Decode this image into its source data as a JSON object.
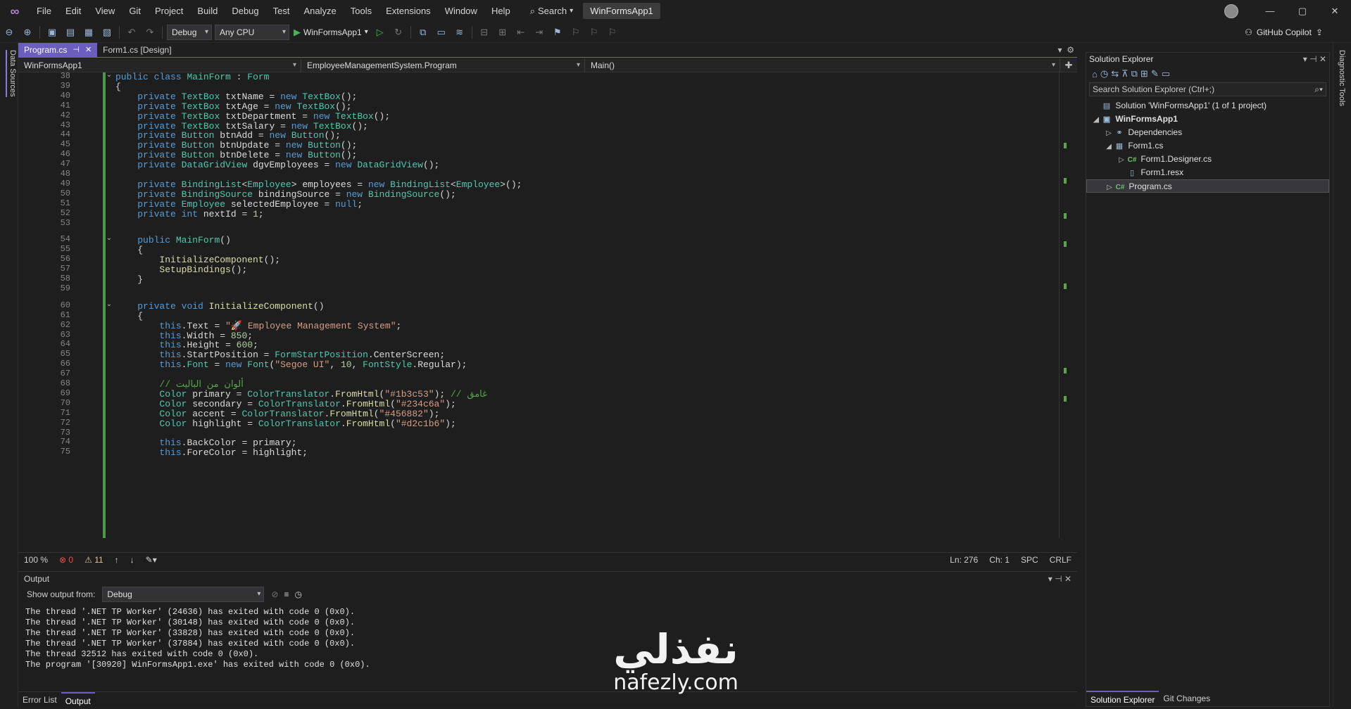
{
  "titlebar": {
    "menu": [
      "File",
      "Edit",
      "View",
      "Git",
      "Project",
      "Build",
      "Debug",
      "Test",
      "Analyze",
      "Tools",
      "Extensions",
      "Window",
      "Help"
    ],
    "search_label": "Search",
    "project_title": "WinFormsApp1",
    "window_controls": [
      "—",
      "▢",
      "✕"
    ]
  },
  "toolbar": {
    "config": "Debug",
    "platform": "Any CPU",
    "run_target": "WinFormsApp1",
    "copilot_label": "GitHub Copilot"
  },
  "left_rail": {
    "label": "Data Sources"
  },
  "right_rail": {
    "label": "Diagnostic Tools"
  },
  "editor": {
    "tabs": [
      {
        "label": "Program.cs",
        "active": true
      },
      {
        "label": "Form1.cs [Design]",
        "active": false
      }
    ],
    "nav": {
      "project": "WinFormsApp1",
      "type": "EmployeeManagementSystem.Program",
      "member": "Main()"
    },
    "lines": [
      {
        "n": "38",
        "code": "public class MainForm : Form"
      },
      {
        "n": "39",
        "code": "{"
      },
      {
        "n": "40",
        "code": "    private TextBox txtName = new TextBox();"
      },
      {
        "n": "41",
        "code": "    private TextBox txtAge = new TextBox();"
      },
      {
        "n": "42",
        "code": "    private TextBox txtDepartment = new TextBox();"
      },
      {
        "n": "43",
        "code": "    private TextBox txtSalary = new TextBox();"
      },
      {
        "n": "44",
        "code": "    private Button btnAdd = new Button();"
      },
      {
        "n": "45",
        "code": "    private Button btnUpdate = new Button();"
      },
      {
        "n": "46",
        "code": "    private Button btnDelete = new Button();"
      },
      {
        "n": "47",
        "code": "    private DataGridView dgvEmployees = new DataGridView();"
      },
      {
        "n": "48",
        "code": ""
      },
      {
        "n": "49",
        "code": "    private BindingList<Employee> employees = new BindingList<Employee>();"
      },
      {
        "n": "50",
        "code": "    private BindingSource bindingSource = new BindingSource();"
      },
      {
        "n": "51",
        "code": "    private Employee selectedEmployee = null;"
      },
      {
        "n": "52",
        "code": "    private int nextId = 1;"
      },
      {
        "n": "53",
        "code": ""
      },
      {
        "n": "54",
        "code": "    public MainForm()"
      },
      {
        "n": "55",
        "code": "    {"
      },
      {
        "n": "56",
        "code": "        InitializeComponent();"
      },
      {
        "n": "57",
        "code": "        SetupBindings();"
      },
      {
        "n": "58",
        "code": "    }"
      },
      {
        "n": "59",
        "code": ""
      },
      {
        "n": "60",
        "code": "    private void InitializeComponent()"
      },
      {
        "n": "61",
        "code": "    {"
      },
      {
        "n": "62",
        "code": "        this.Text = \"🚀 Employee Management System\";"
      },
      {
        "n": "63",
        "code": "        this.Width = 850;"
      },
      {
        "n": "64",
        "code": "        this.Height = 600;"
      },
      {
        "n": "65",
        "code": "        this.StartPosition = FormStartPosition.CenterScreen;"
      },
      {
        "n": "66",
        "code": "        this.Font = new Font(\"Segoe UI\", 10, FontStyle.Regular);"
      },
      {
        "n": "67",
        "code": ""
      },
      {
        "n": "68",
        "code": "        // ألوان من الباليت"
      },
      {
        "n": "69",
        "code": "        Color primary = ColorTranslator.FromHtml(\"#1b3c53\"); // غامق"
      },
      {
        "n": "70",
        "code": "        Color secondary = ColorTranslator.FromHtml(\"#234c6a\");"
      },
      {
        "n": "71",
        "code": "        Color accent = ColorTranslator.FromHtml(\"#456882\");"
      },
      {
        "n": "72",
        "code": "        Color highlight = ColorTranslator.FromHtml(\"#d2c1b6\");"
      },
      {
        "n": "73",
        "code": ""
      },
      {
        "n": "74",
        "code": "        this.BackColor = primary;"
      },
      {
        "n": "75",
        "code": "        this.ForeColor = highlight;"
      }
    ],
    "status": {
      "zoom": "100 %",
      "errors": "0",
      "warnings": "11",
      "ln": "Ln: 276",
      "ch": "Ch: 1",
      "spc": "SPC",
      "eol": "CRLF"
    }
  },
  "output": {
    "title": "Output",
    "show_from_label": "Show output from:",
    "source": "Debug",
    "lines": [
      "The thread '.NET TP Worker' (24636) has exited with code 0 (0x0).",
      "The thread '.NET TP Worker' (30148) has exited with code 0 (0x0).",
      "The thread '.NET TP Worker' (33828) has exited with code 0 (0x0).",
      "The thread '.NET TP Worker' (37884) has exited with code 0 (0x0).",
      "The thread 32512 has exited with code 0 (0x0).",
      "The program '[30920] WinFormsApp1.exe' has exited with code 0 (0x0)."
    ],
    "tabs": [
      "Error List",
      "Output"
    ]
  },
  "watermark": {
    "arabic": "نفذلي",
    "latin": "nafezly.com"
  },
  "solution_explorer": {
    "title": "Solution Explorer",
    "search_placeholder": "Search Solution Explorer (Ctrl+;)",
    "items": [
      {
        "label": "Solution 'WinFormsApp1' (1 of 1 project)"
      },
      {
        "label": "WinFormsApp1"
      },
      {
        "label": "Dependencies"
      },
      {
        "label": "Form1.cs"
      },
      {
        "label": "Form1.Designer.cs"
      },
      {
        "label": "Form1.resx"
      },
      {
        "label": "Program.cs"
      }
    ],
    "tabs": [
      "Solution Explorer",
      "Git Changes"
    ]
  }
}
